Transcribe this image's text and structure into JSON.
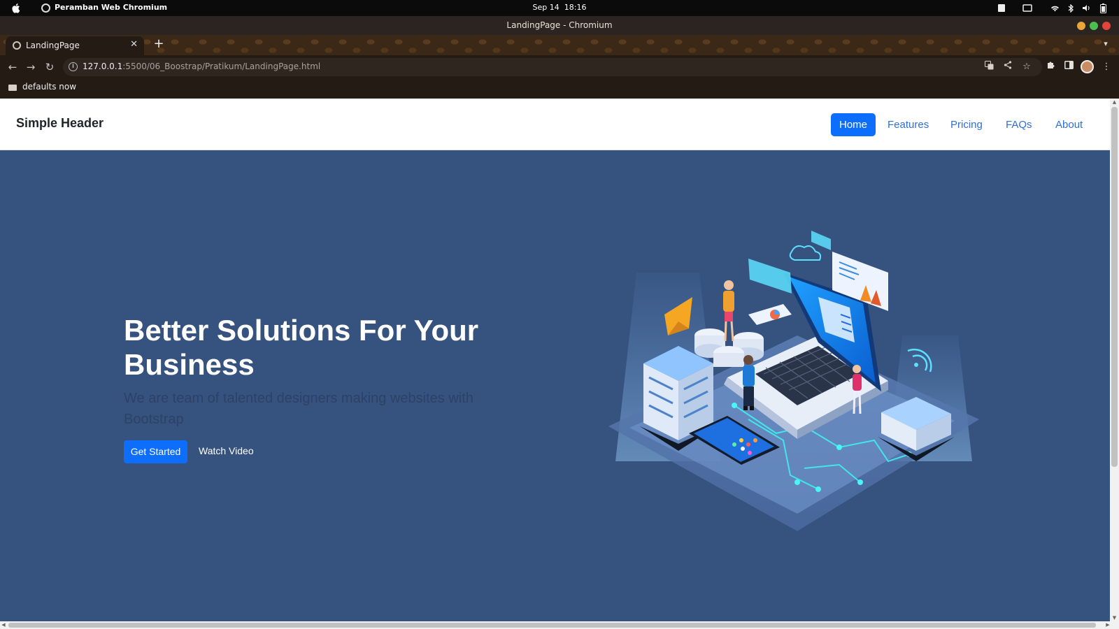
{
  "os": {
    "app_name": "Peramban Web Chromium",
    "date": "Sep 14",
    "time": "18:16"
  },
  "window": {
    "title": "LandingPage - Chromium"
  },
  "tabs": [
    {
      "label": "LandingPage"
    }
  ],
  "toolbar": {
    "url_host": "127.0.0.1",
    "url_path": ":5500/06_Boostrap/Pratikum/LandingPage.html"
  },
  "bookmarks": [
    {
      "label": "defaults now"
    }
  ],
  "site": {
    "brand": "Simple Header",
    "nav": [
      {
        "label": "Home",
        "active": true
      },
      {
        "label": "Features",
        "active": false
      },
      {
        "label": "Pricing",
        "active": false
      },
      {
        "label": "FAQs",
        "active": false
      },
      {
        "label": "About",
        "active": false
      }
    ],
    "hero": {
      "title": "Better Solutions For Your Business",
      "subtitle": "We are team of talented designers making websites with Bootstrap",
      "cta_primary": "Get Started",
      "cta_secondary": "Watch Video"
    }
  },
  "colors": {
    "hero_bg": "#36527e",
    "accent": "#0d6efd",
    "link": "#2f6fd9"
  }
}
